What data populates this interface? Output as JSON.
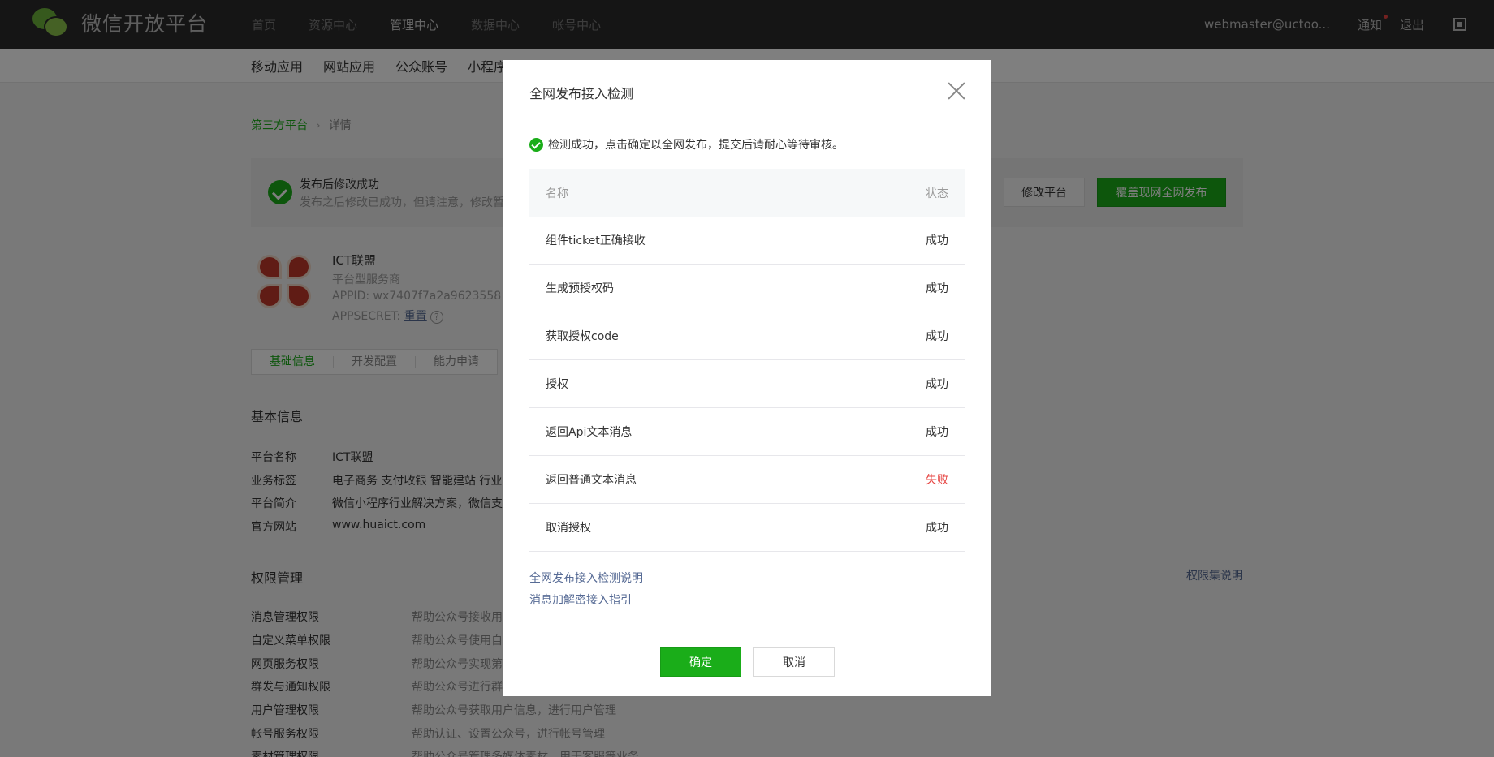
{
  "header": {
    "logo_text": "微信开放平台",
    "nav": [
      "首页",
      "资源中心",
      "管理中心",
      "数据中心",
      "帐号中心"
    ],
    "user": "webmaster@uctoo...",
    "notice": "通知",
    "logout": "退出"
  },
  "subnav": [
    "移动应用",
    "网站应用",
    "公众账号",
    "小程序"
  ],
  "breadcrumb": {
    "parent": "第三方平台",
    "current": "详情"
  },
  "notice_bar": {
    "title": "发布后修改成功",
    "desc": "发布之后修改已成功，但请注意，修改暂",
    "modify_button": "修改平台",
    "publish_button": "覆盖现网全网发布"
  },
  "app": {
    "name": "ICT联盟",
    "type": "平台型服务商",
    "appid": "APPID: wx7407f7a2a9623558",
    "secret_label": "APPSECRET: ",
    "secret_reset": "重置",
    "help": "?"
  },
  "tabs": [
    "基础信息",
    "开发配置",
    "能力申请"
  ],
  "basic_info": {
    "title": "基本信息",
    "rows": [
      {
        "k": "平台名称",
        "v": "ICT联盟"
      },
      {
        "k": "业务标签",
        "v": "电子商务 支付收银 智能建站 行业"
      },
      {
        "k": "平台简介",
        "v": "微信小程序行业解决方案，微信支"
      },
      {
        "k": "官方网站",
        "v": "www.huaict.com"
      }
    ]
  },
  "permissions": {
    "title": "权限管理",
    "link": "权限集说明",
    "rows": [
      {
        "k": "消息管理权限",
        "v": "帮助公众号接收用"
      },
      {
        "k": "自定义菜单权限",
        "v": "帮助公众号使用自"
      },
      {
        "k": "网页服务权限",
        "v": "帮助公众号实现第"
      },
      {
        "k": "群发与通知权限",
        "v": "帮助公众号进行群"
      },
      {
        "k": "用户管理权限",
        "v": "帮助公众号获取用户信息，进行用户管理"
      },
      {
        "k": "帐号服务权限",
        "v": "帮助认证、设置公众号，进行帐号管理"
      },
      {
        "k": "素材管理权限",
        "v": "帮助公众号管理多媒体素材，用于客服等业务"
      }
    ]
  },
  "dialog": {
    "title": "全网发布接入检测",
    "message": "检测成功，点击确定以全网发布，提交后请耐心等待审核。",
    "table_head": {
      "name": "名称",
      "status": "状态"
    },
    "rows": [
      {
        "name": "组件ticket正确接收",
        "status": "成功"
      },
      {
        "name": "生成预授权码",
        "status": "成功"
      },
      {
        "name": "获取授权code",
        "status": "成功"
      },
      {
        "name": "授权",
        "status": "成功"
      },
      {
        "name": "返回Api文本消息",
        "status": "成功"
      },
      {
        "name": "返回普通文本消息",
        "status": "失败"
      },
      {
        "name": "取消授权",
        "status": "成功"
      }
    ],
    "link1": "全网发布接入检测说明",
    "link2": "消息加解密接入指引",
    "ok": "确定",
    "cancel": "取消"
  }
}
